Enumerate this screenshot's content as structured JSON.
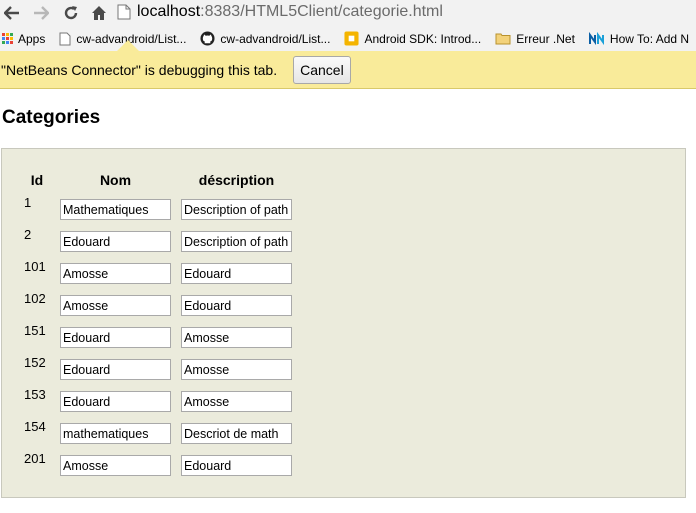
{
  "browser": {
    "url_host": "localhost",
    "url_rest": ":8383/HTML5Client/categorie.html"
  },
  "bookmarks": [
    {
      "label": "Apps",
      "icon": "apps-grid-icon"
    },
    {
      "label": "cw-advandroid/List...",
      "icon": "page-icon"
    },
    {
      "label": "cw-advandroid/List...",
      "icon": "github-icon"
    },
    {
      "label": "Android SDK: Introd...",
      "icon": "android-sdk-icon"
    },
    {
      "label": "Erreur .Net",
      "icon": "folder-icon"
    },
    {
      "label": "How To: Add N",
      "icon": "aspnet-icon"
    }
  ],
  "infobar": {
    "message": "\"NetBeans Connector\" is debugging this tab.",
    "cancel_label": "Cancel"
  },
  "page": {
    "title": "Categories",
    "headers": {
      "id": "Id",
      "nom": "Nom",
      "description": "déscription"
    },
    "rows": [
      {
        "id": "1",
        "nom": "Mathematiques",
        "description": "Description of path"
      },
      {
        "id": "2",
        "nom": "Edouard",
        "description": "Description of path"
      },
      {
        "id": "101",
        "nom": "Amosse",
        "description": "Edouard"
      },
      {
        "id": "102",
        "nom": "Amosse",
        "description": "Edouard"
      },
      {
        "id": "151",
        "nom": "Edouard",
        "description": "Amosse"
      },
      {
        "id": "152",
        "nom": "Edouard",
        "description": "Amosse"
      },
      {
        "id": "153",
        "nom": "Edouard",
        "description": "Amosse"
      },
      {
        "id": "154",
        "nom": "mathematiques",
        "description": "Descriot de math"
      },
      {
        "id": "201",
        "nom": "Amosse",
        "description": "Edouard"
      }
    ]
  },
  "colors": {
    "infobar": "#f9eb9a",
    "panel": "#ebebdc"
  }
}
